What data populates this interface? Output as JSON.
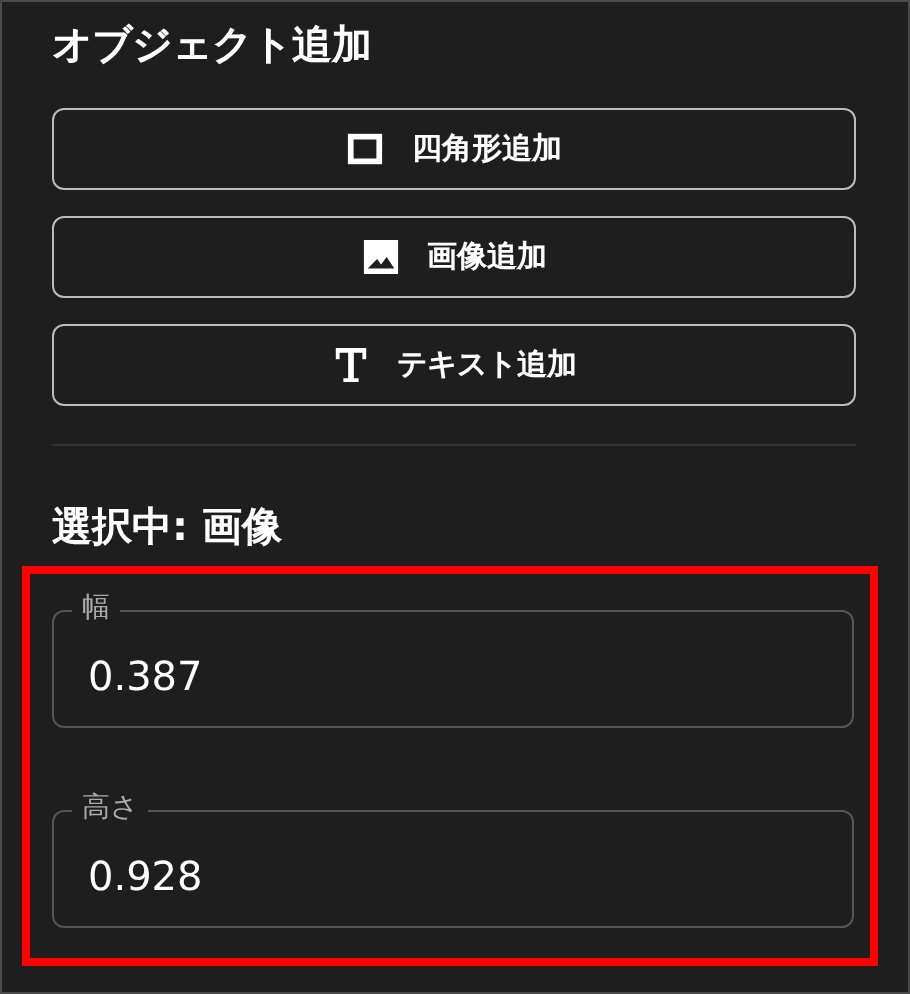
{
  "add_section": {
    "title": "オブジェクト追加"
  },
  "add_buttons": [
    {
      "kind": "rectangle",
      "label": "四角形追加"
    },
    {
      "kind": "image",
      "label": "画像追加"
    },
    {
      "kind": "text",
      "label": "テキスト追加"
    }
  ],
  "selection": {
    "title": "選択中: 画像",
    "fields": [
      {
        "label": "幅",
        "value": "0.387"
      },
      {
        "label": "高さ",
        "value": "0.928"
      }
    ]
  }
}
